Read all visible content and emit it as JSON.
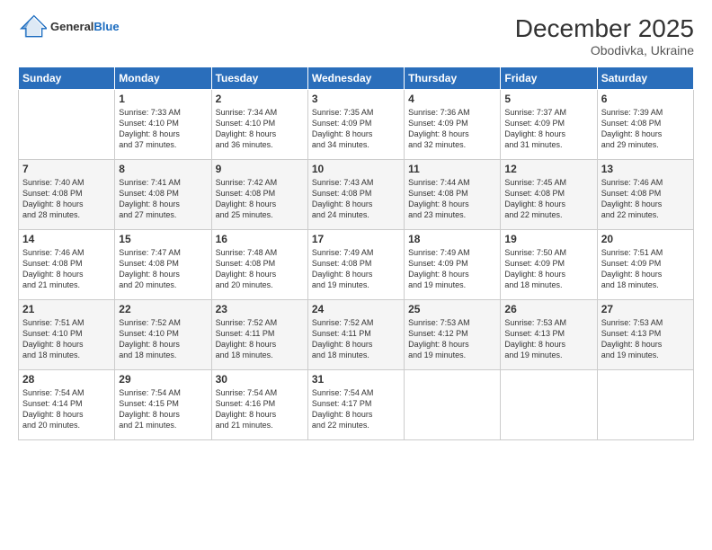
{
  "header": {
    "logo_general": "General",
    "logo_blue": "Blue",
    "month_title": "December 2025",
    "location": "Obodivka, Ukraine"
  },
  "days_of_week": [
    "Sunday",
    "Monday",
    "Tuesday",
    "Wednesday",
    "Thursday",
    "Friday",
    "Saturday"
  ],
  "weeks": [
    [
      {
        "day": "",
        "info": ""
      },
      {
        "day": "1",
        "info": "Sunrise: 7:33 AM\nSunset: 4:10 PM\nDaylight: 8 hours\nand 37 minutes."
      },
      {
        "day": "2",
        "info": "Sunrise: 7:34 AM\nSunset: 4:10 PM\nDaylight: 8 hours\nand 36 minutes."
      },
      {
        "day": "3",
        "info": "Sunrise: 7:35 AM\nSunset: 4:09 PM\nDaylight: 8 hours\nand 34 minutes."
      },
      {
        "day": "4",
        "info": "Sunrise: 7:36 AM\nSunset: 4:09 PM\nDaylight: 8 hours\nand 32 minutes."
      },
      {
        "day": "5",
        "info": "Sunrise: 7:37 AM\nSunset: 4:09 PM\nDaylight: 8 hours\nand 31 minutes."
      },
      {
        "day": "6",
        "info": "Sunrise: 7:39 AM\nSunset: 4:08 PM\nDaylight: 8 hours\nand 29 minutes."
      }
    ],
    [
      {
        "day": "7",
        "info": "Sunrise: 7:40 AM\nSunset: 4:08 PM\nDaylight: 8 hours\nand 28 minutes."
      },
      {
        "day": "8",
        "info": "Sunrise: 7:41 AM\nSunset: 4:08 PM\nDaylight: 8 hours\nand 27 minutes."
      },
      {
        "day": "9",
        "info": "Sunrise: 7:42 AM\nSunset: 4:08 PM\nDaylight: 8 hours\nand 25 minutes."
      },
      {
        "day": "10",
        "info": "Sunrise: 7:43 AM\nSunset: 4:08 PM\nDaylight: 8 hours\nand 24 minutes."
      },
      {
        "day": "11",
        "info": "Sunrise: 7:44 AM\nSunset: 4:08 PM\nDaylight: 8 hours\nand 23 minutes."
      },
      {
        "day": "12",
        "info": "Sunrise: 7:45 AM\nSunset: 4:08 PM\nDaylight: 8 hours\nand 22 minutes."
      },
      {
        "day": "13",
        "info": "Sunrise: 7:46 AM\nSunset: 4:08 PM\nDaylight: 8 hours\nand 22 minutes."
      }
    ],
    [
      {
        "day": "14",
        "info": "Sunrise: 7:46 AM\nSunset: 4:08 PM\nDaylight: 8 hours\nand 21 minutes."
      },
      {
        "day": "15",
        "info": "Sunrise: 7:47 AM\nSunset: 4:08 PM\nDaylight: 8 hours\nand 20 minutes."
      },
      {
        "day": "16",
        "info": "Sunrise: 7:48 AM\nSunset: 4:08 PM\nDaylight: 8 hours\nand 20 minutes."
      },
      {
        "day": "17",
        "info": "Sunrise: 7:49 AM\nSunset: 4:08 PM\nDaylight: 8 hours\nand 19 minutes."
      },
      {
        "day": "18",
        "info": "Sunrise: 7:49 AM\nSunset: 4:09 PM\nDaylight: 8 hours\nand 19 minutes."
      },
      {
        "day": "19",
        "info": "Sunrise: 7:50 AM\nSunset: 4:09 PM\nDaylight: 8 hours\nand 18 minutes."
      },
      {
        "day": "20",
        "info": "Sunrise: 7:51 AM\nSunset: 4:09 PM\nDaylight: 8 hours\nand 18 minutes."
      }
    ],
    [
      {
        "day": "21",
        "info": "Sunrise: 7:51 AM\nSunset: 4:10 PM\nDaylight: 8 hours\nand 18 minutes."
      },
      {
        "day": "22",
        "info": "Sunrise: 7:52 AM\nSunset: 4:10 PM\nDaylight: 8 hours\nand 18 minutes."
      },
      {
        "day": "23",
        "info": "Sunrise: 7:52 AM\nSunset: 4:11 PM\nDaylight: 8 hours\nand 18 minutes."
      },
      {
        "day": "24",
        "info": "Sunrise: 7:52 AM\nSunset: 4:11 PM\nDaylight: 8 hours\nand 18 minutes."
      },
      {
        "day": "25",
        "info": "Sunrise: 7:53 AM\nSunset: 4:12 PM\nDaylight: 8 hours\nand 19 minutes."
      },
      {
        "day": "26",
        "info": "Sunrise: 7:53 AM\nSunset: 4:13 PM\nDaylight: 8 hours\nand 19 minutes."
      },
      {
        "day": "27",
        "info": "Sunrise: 7:53 AM\nSunset: 4:13 PM\nDaylight: 8 hours\nand 19 minutes."
      }
    ],
    [
      {
        "day": "28",
        "info": "Sunrise: 7:54 AM\nSunset: 4:14 PM\nDaylight: 8 hours\nand 20 minutes."
      },
      {
        "day": "29",
        "info": "Sunrise: 7:54 AM\nSunset: 4:15 PM\nDaylight: 8 hours\nand 21 minutes."
      },
      {
        "day": "30",
        "info": "Sunrise: 7:54 AM\nSunset: 4:16 PM\nDaylight: 8 hours\nand 21 minutes."
      },
      {
        "day": "31",
        "info": "Sunrise: 7:54 AM\nSunset: 4:17 PM\nDaylight: 8 hours\nand 22 minutes."
      },
      {
        "day": "",
        "info": ""
      },
      {
        "day": "",
        "info": ""
      },
      {
        "day": "",
        "info": ""
      }
    ]
  ]
}
